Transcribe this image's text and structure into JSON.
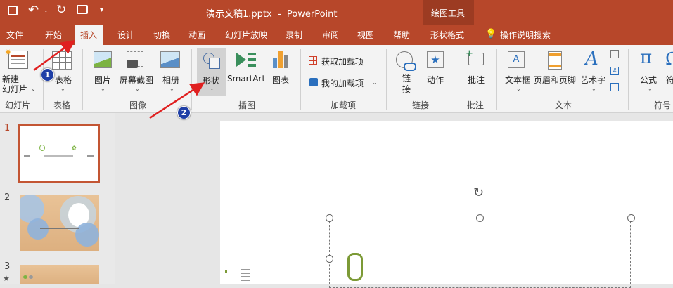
{
  "titlebar": {
    "title": "演示文稿1.pptx  -  PowerPoint",
    "context_group": "绘图工具"
  },
  "tabs": [
    "文件",
    "开始",
    "插入",
    "设计",
    "切换",
    "动画",
    "幻灯片放映",
    "录制",
    "审阅",
    "视图",
    "帮助",
    "形状格式"
  ],
  "tell_me": "操作说明搜索",
  "ribbon": {
    "new_slide": "新建\n幻灯片",
    "table": "表格",
    "picture": "图片",
    "screenshot": "屏幕截图",
    "album": "相册",
    "shapes": "形状",
    "smartart": "SmartArt",
    "chart": "图表",
    "get_addins": "获取加载项",
    "my_addins": "我的加载项",
    "link": "链\n接",
    "action": "动作",
    "comment": "批注",
    "textbox": "文本框",
    "header_footer": "页眉和页脚",
    "wordart": "艺术字",
    "equation": "公式",
    "symbol_partial": "符"
  },
  "groups": {
    "slides": "幻灯片",
    "tables": "表格",
    "images": "图像",
    "illustrations": "插图",
    "addins": "加载项",
    "links": "链接",
    "comments": "批注",
    "text": "文本",
    "symbols": "符号"
  },
  "thumbnails": [
    {
      "number": "1"
    },
    {
      "number": "2"
    },
    {
      "number": "3"
    }
  ],
  "annotations": {
    "step1": "1",
    "step2": "2"
  },
  "colors": {
    "brand": "#b7472a",
    "context_tab": "#9c3b22",
    "annotation_arrow": "#e02020",
    "badge": "#1f3fa6"
  }
}
